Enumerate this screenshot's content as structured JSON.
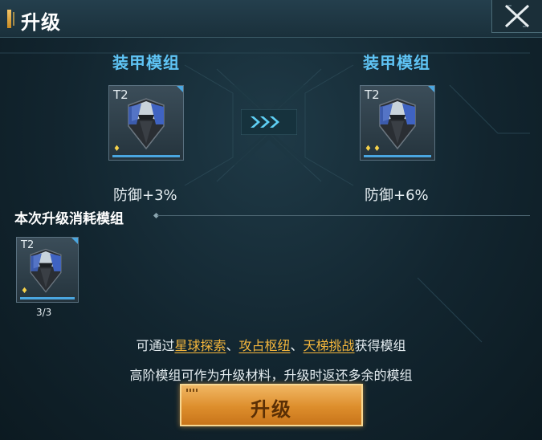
{
  "header": {
    "title": "升级"
  },
  "left_module": {
    "name": "装甲模组",
    "tier": "T2",
    "stars": 1,
    "stat": "防御+3%"
  },
  "right_module": {
    "name": "装甲模组",
    "tier": "T2",
    "stars": 2,
    "stat": "防御+6%"
  },
  "consume": {
    "label": "本次升级消耗模组",
    "item": {
      "tier": "T2",
      "stars": 1,
      "count": "3/3"
    }
  },
  "hint": {
    "prefix": "可通过",
    "link1": "星球探索",
    "sep1": "、",
    "link2": "攻占枢纽",
    "sep2": "、",
    "link3": "天梯挑战",
    "suffix": "获得模组",
    "line2": "高阶模组可作为升级材料，升级时返还多余的模组"
  },
  "actions": {
    "upgrade_label": "升级"
  },
  "icons": {
    "close": "close-icon",
    "armor": "armor-module-icon",
    "arrow": "upgrade-arrow-icon"
  },
  "colors": {
    "accent_blue": "#5fc4f5",
    "gold": "#f4b63c",
    "button": "#dd8e2c"
  }
}
